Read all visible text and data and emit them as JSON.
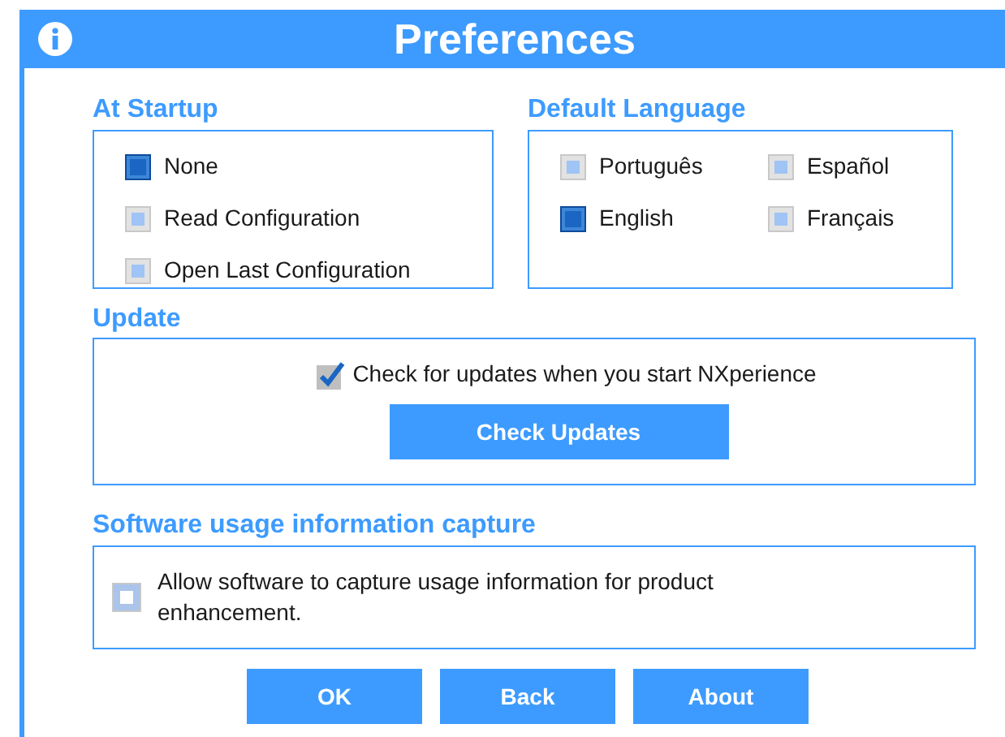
{
  "window": {
    "title": "Preferences"
  },
  "at_startup": {
    "heading": "At Startup",
    "options": [
      {
        "label": "None",
        "selected": true
      },
      {
        "label": "Read Configuration",
        "selected": false
      },
      {
        "label": "Open Last Configuration",
        "selected": false
      }
    ]
  },
  "default_language": {
    "heading": "Default Language",
    "options": [
      {
        "label": "Português",
        "selected": false
      },
      {
        "label": "Español",
        "selected": false
      },
      {
        "label": "English",
        "selected": true
      },
      {
        "label": "Français",
        "selected": false
      }
    ]
  },
  "update": {
    "heading": "Update",
    "check_label": "Check for updates when you start NXperience",
    "checked": true,
    "button": "Check Updates"
  },
  "usage": {
    "heading": "Software usage information capture",
    "label": "Allow software to capture usage information for product enhancement.",
    "checked": false
  },
  "buttons": [
    "OK",
    "Back",
    "About"
  ]
}
